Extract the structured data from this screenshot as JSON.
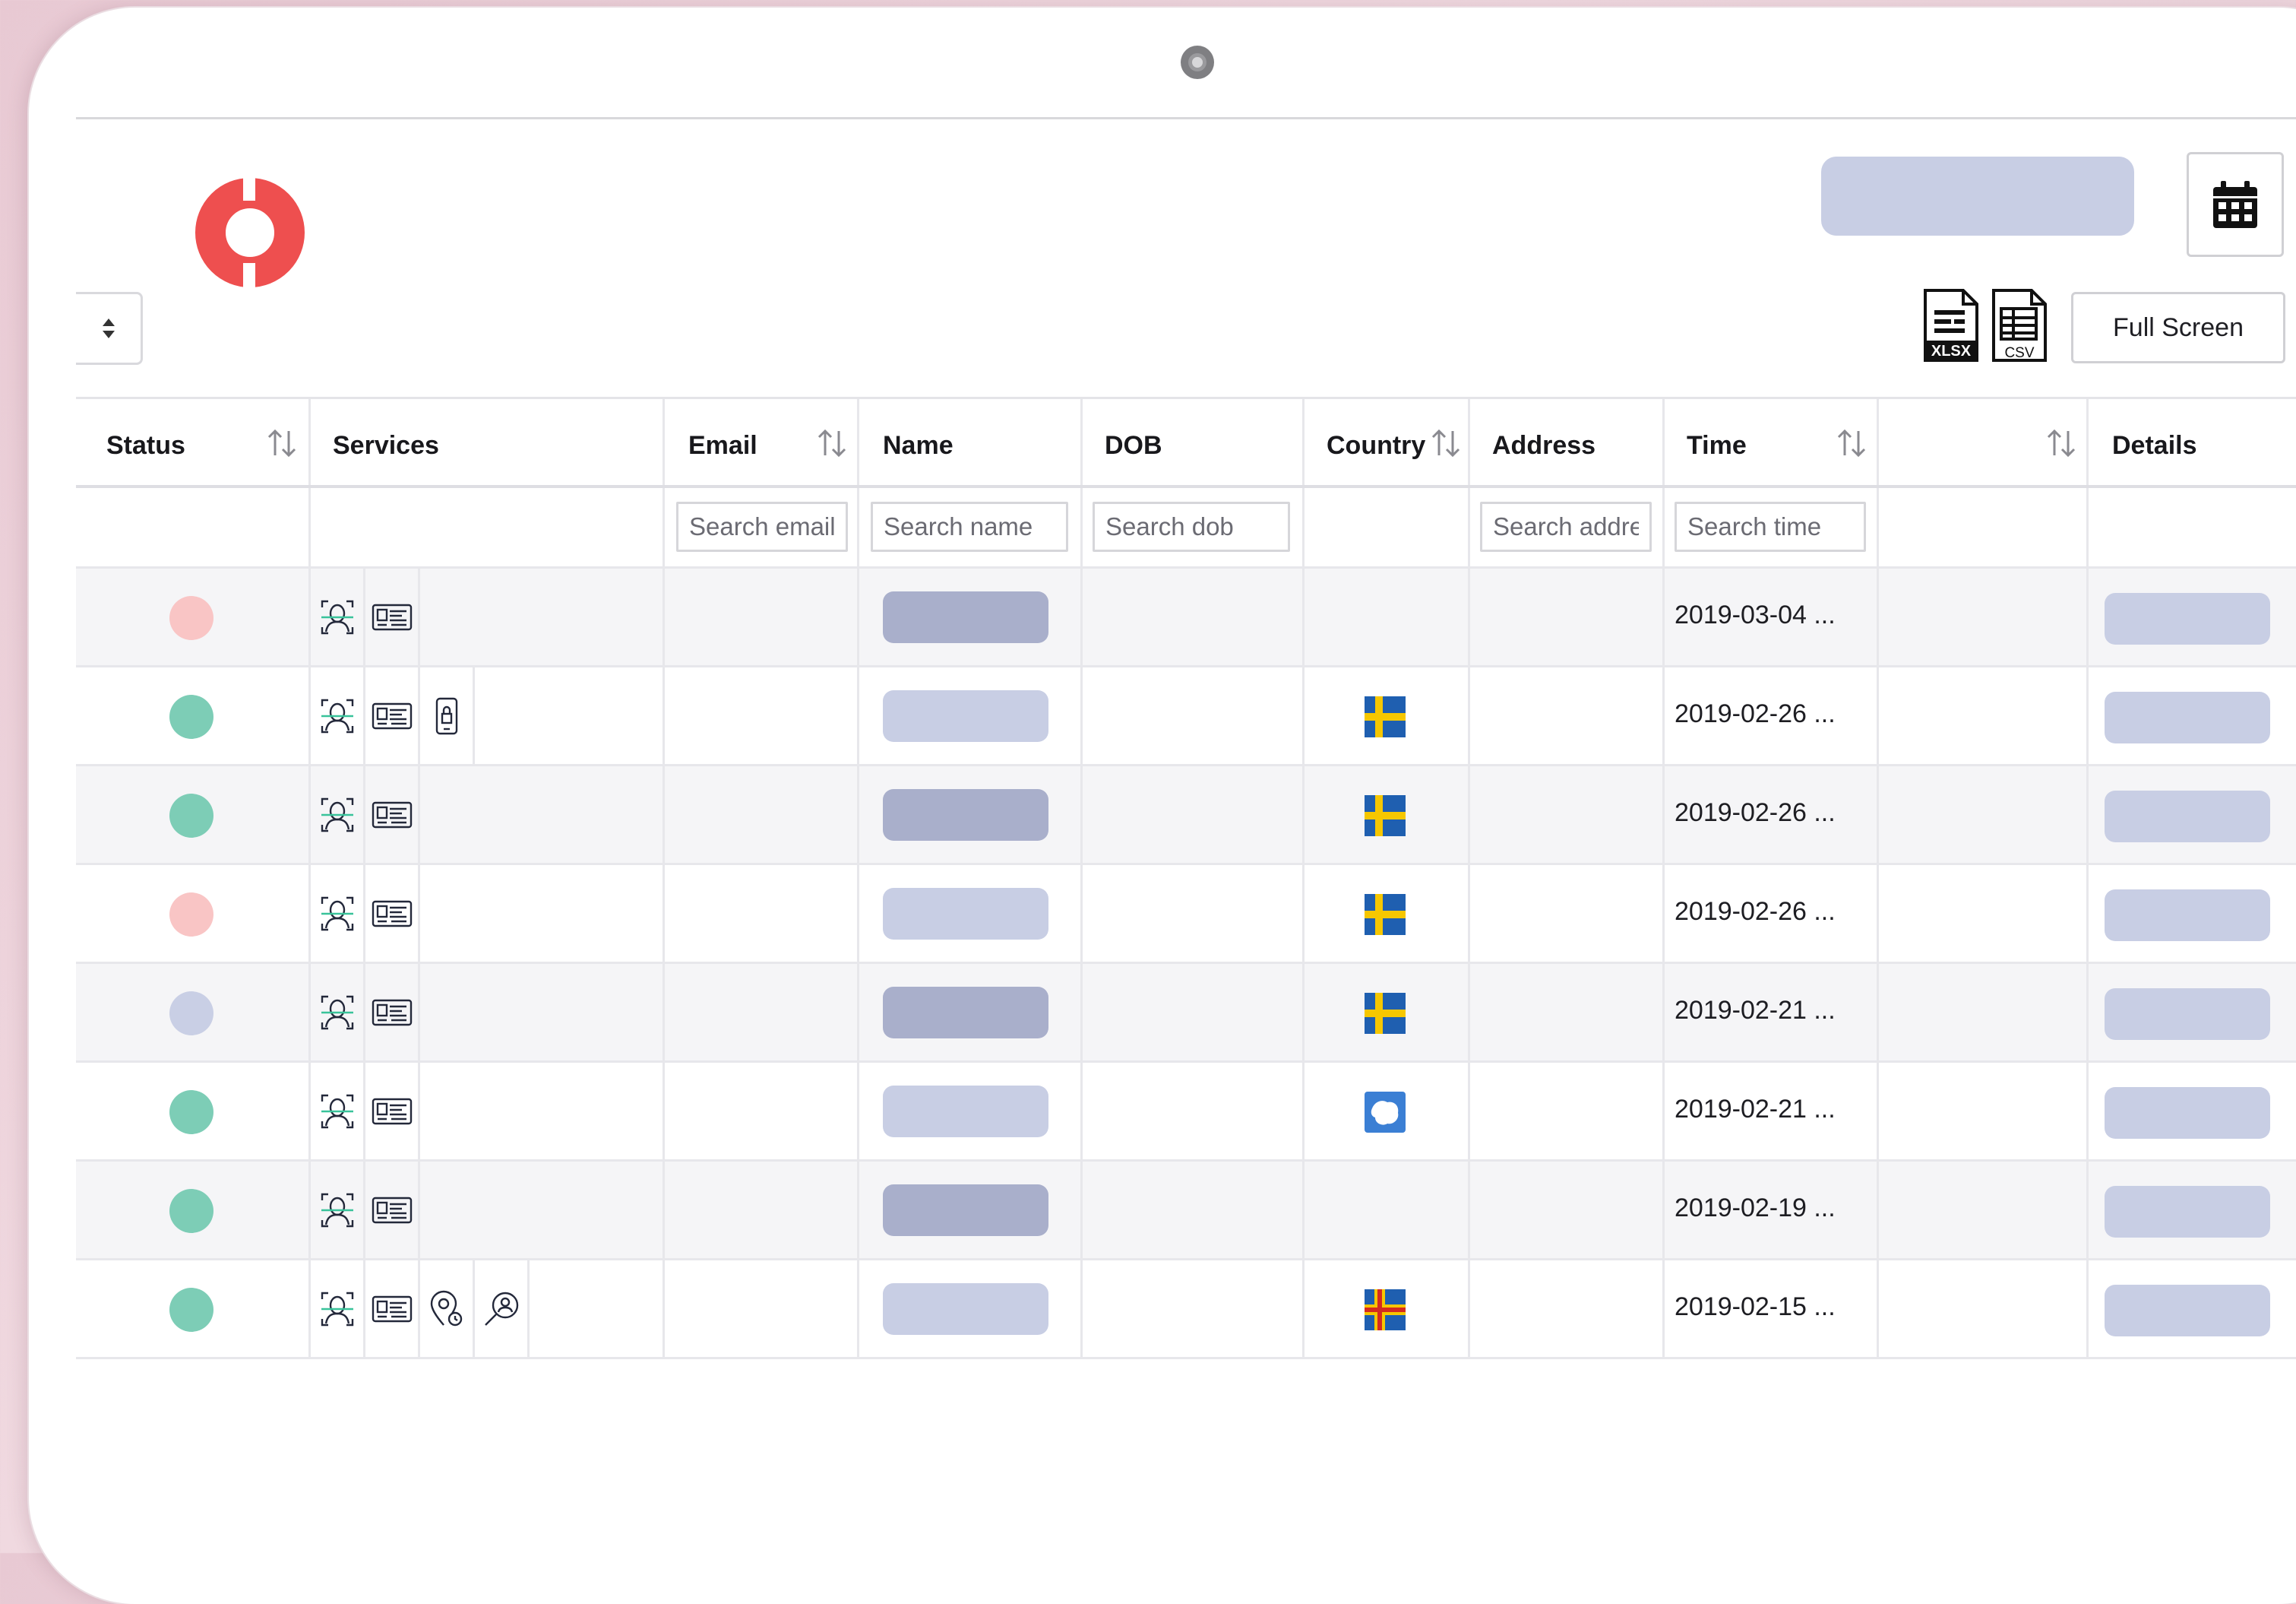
{
  "colors": {
    "accent_logo": "#ee4f4f",
    "status_green": "#7dcdb6",
    "status_pink": "#f9c5c5",
    "status_lavender": "#c9cfe5",
    "pill_dark": "#a9afcb",
    "pill_light": "#c8cee4"
  },
  "toolbar": {
    "full_screen_label": "Full Screen",
    "xlsx_label": "XLSX",
    "csv_label": "CSV",
    "calendar_icon": "calendar-icon",
    "sort_icon": "sort-updown-icon"
  },
  "table": {
    "headers": [
      {
        "key": "status",
        "label": "Status",
        "sortable": true
      },
      {
        "key": "services",
        "label": "Services",
        "sortable": false
      },
      {
        "key": "email",
        "label": "Email",
        "sortable": true
      },
      {
        "key": "name",
        "label": "Name",
        "sortable": false
      },
      {
        "key": "dob",
        "label": "DOB",
        "sortable": false
      },
      {
        "key": "country",
        "label": "Country",
        "sortable": true
      },
      {
        "key": "address",
        "label": "Address",
        "sortable": false
      },
      {
        "key": "time",
        "label": "Time",
        "sortable": true
      },
      {
        "key": "blank",
        "label": "",
        "sortable": true
      },
      {
        "key": "details",
        "label": "Details",
        "sortable": false
      }
    ],
    "filters": {
      "email_placeholder": "Search email",
      "name_placeholder": "Search name",
      "dob_placeholder": "Search dob",
      "address_placeholder": "Search addre",
      "time_placeholder": "Search time"
    },
    "rows": [
      {
        "status": "pink",
        "services": [
          "face-scan-icon",
          "id-card-icon"
        ],
        "name_shade": "dark",
        "country": "",
        "time": "2019-03-04 ..."
      },
      {
        "status": "green",
        "services": [
          "face-scan-icon",
          "id-card-icon",
          "phone-lock-icon"
        ],
        "name_shade": "light",
        "country": "sweden-flag",
        "time": "2019-02-26 ..."
      },
      {
        "status": "green",
        "services": [
          "face-scan-icon",
          "id-card-icon"
        ],
        "name_shade": "dark",
        "country": "sweden-flag",
        "time": "2019-02-26 ..."
      },
      {
        "status": "pink",
        "services": [
          "face-scan-icon",
          "id-card-icon"
        ],
        "name_shade": "light",
        "country": "sweden-flag",
        "time": "2019-02-26 ..."
      },
      {
        "status": "lavender",
        "services": [
          "face-scan-icon",
          "id-card-icon"
        ],
        "name_shade": "dark",
        "country": "sweden-flag",
        "time": "2019-02-21 ..."
      },
      {
        "status": "green",
        "services": [
          "face-scan-icon",
          "id-card-icon"
        ],
        "name_shade": "light",
        "country": "antarctica-flag",
        "time": "2019-02-21 ..."
      },
      {
        "status": "green",
        "services": [
          "face-scan-icon",
          "id-card-icon"
        ],
        "name_shade": "dark",
        "country": "",
        "time": "2019-02-19 ..."
      },
      {
        "status": "green",
        "services": [
          "face-scan-icon",
          "id-card-icon",
          "location-pin-icon",
          "search-person-icon"
        ],
        "name_shade": "light",
        "country": "aland-flag",
        "time": "2019-02-15 ..."
      }
    ]
  }
}
